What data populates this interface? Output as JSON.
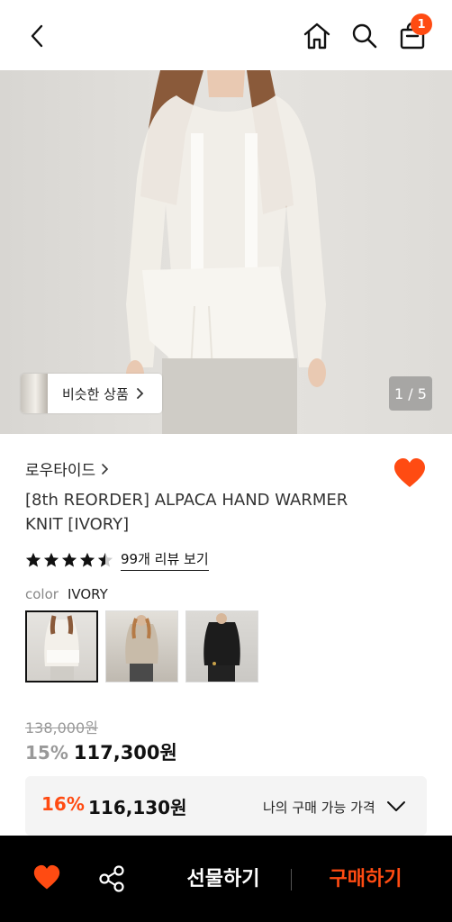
{
  "header": {
    "cart_count": "1"
  },
  "hero": {
    "similar_label": "비슷한 상품",
    "counter": "1 / 5"
  },
  "product": {
    "brand": "로우타이드",
    "title": "[8th REORDER] ALPACA HAND WARMER KNIT [IVORY]",
    "rating": 4.5,
    "reviews_label": "99개 리뷰 보기",
    "color_label": "color",
    "color_value": "IVORY",
    "original_price": "138,000원",
    "discount": "15%",
    "sale_price": "117,300원"
  },
  "coupon": {
    "discount": "16%",
    "price": "116,130원",
    "label": "나의 구매 가능 가격"
  },
  "bottom": {
    "gift_label": "선물하기",
    "buy_label": "구매하기"
  },
  "colors": {
    "accent": "#ff4b12",
    "bar": "#000000"
  }
}
